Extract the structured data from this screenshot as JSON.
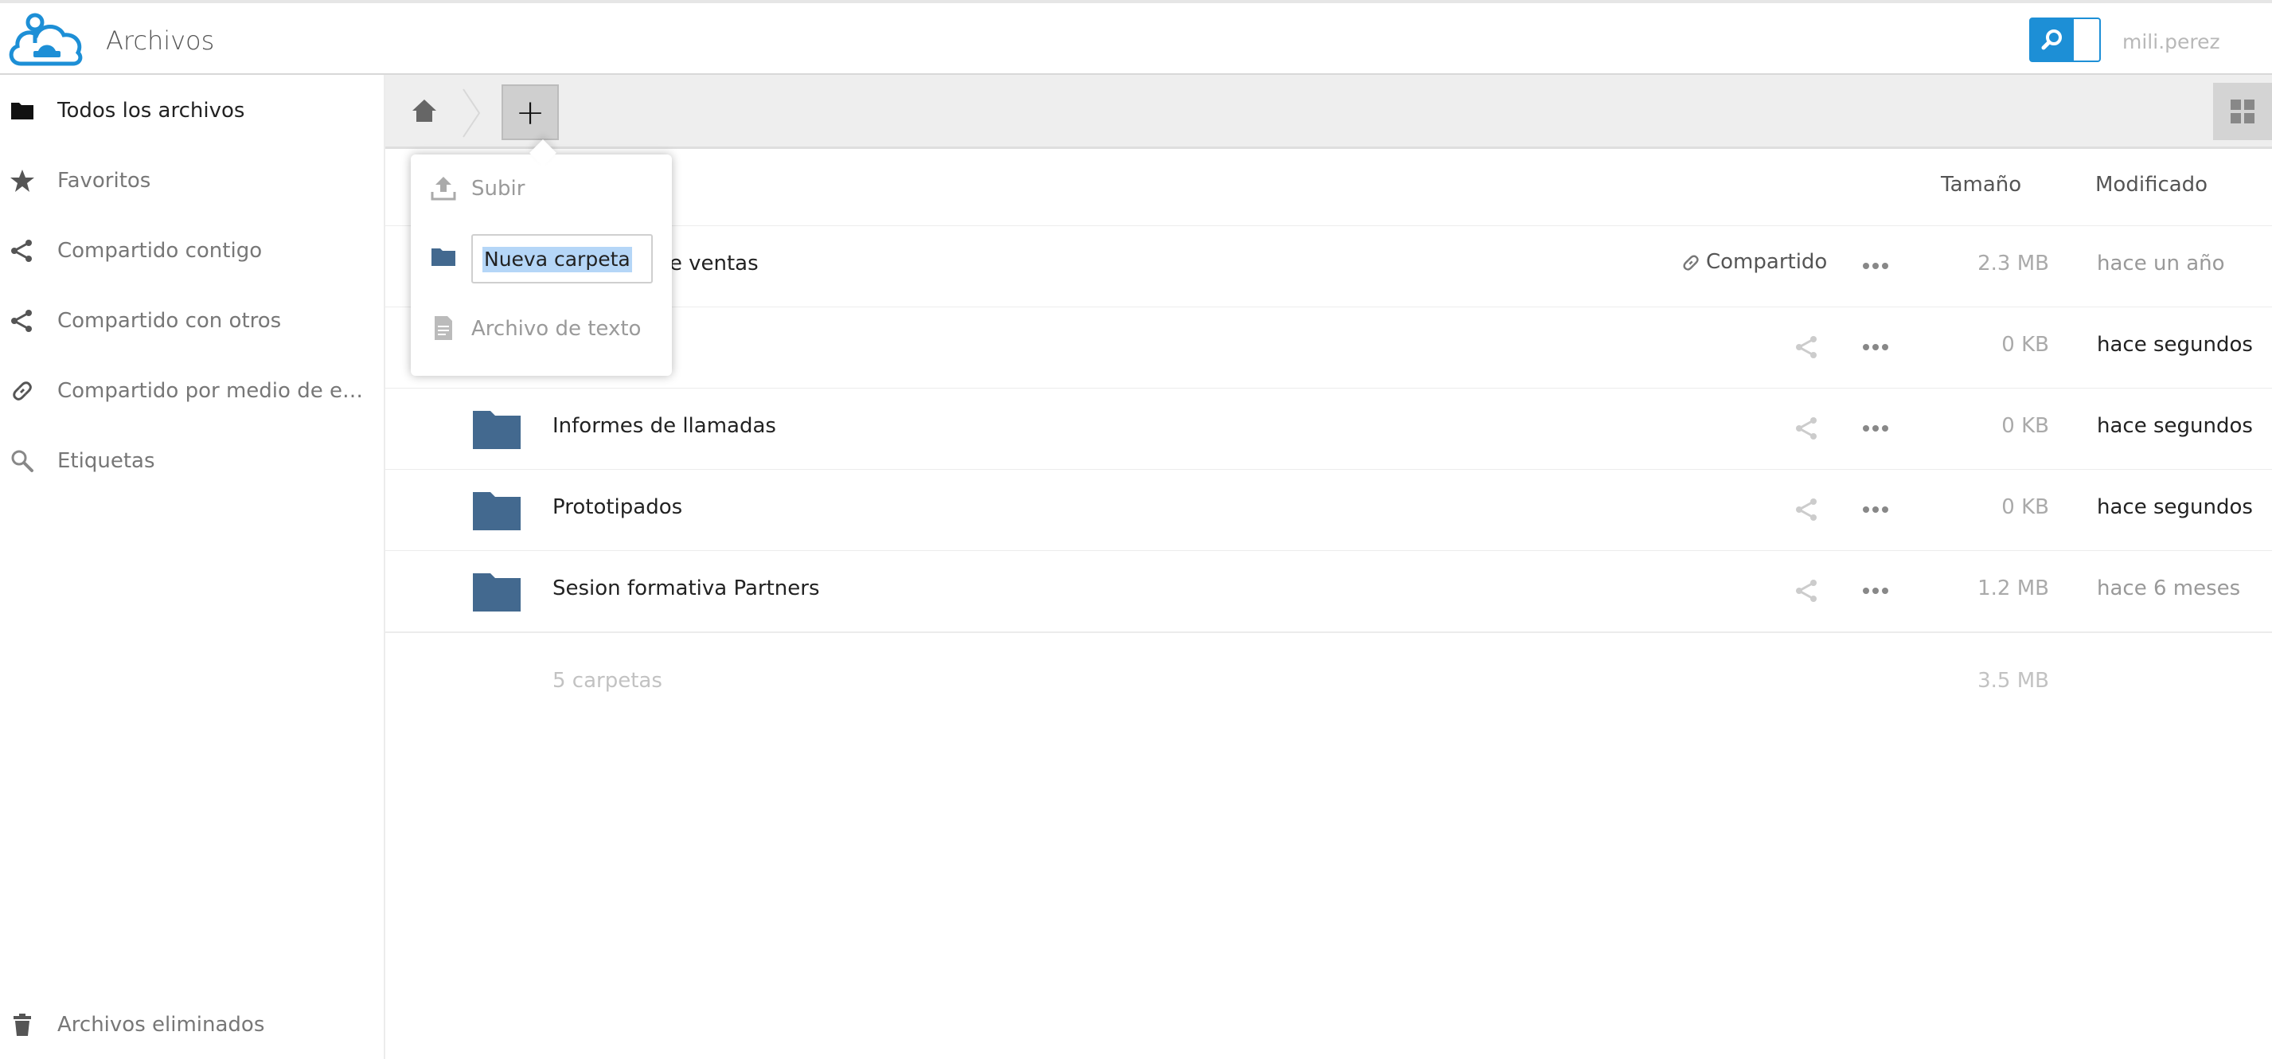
{
  "header": {
    "app_title": "Archivos",
    "username": "mili.perez",
    "accent_color": "#1d8fd6"
  },
  "sidebar": {
    "items": [
      {
        "label": "Todos los archivos",
        "icon": "folder-icon"
      },
      {
        "label": "Favoritos",
        "icon": "star-icon"
      },
      {
        "label": "Compartido contigo",
        "icon": "share-icon"
      },
      {
        "label": "Compartido con otros",
        "icon": "share-icon"
      },
      {
        "label": "Compartido por medio de enlac...",
        "icon": "link-icon"
      },
      {
        "label": "Etiquetas",
        "icon": "tag-search-icon"
      }
    ],
    "trash_label": "Archivos eliminados"
  },
  "controls": {
    "new_button_label": "+"
  },
  "new_menu": {
    "upload_label": "Subir",
    "new_folder_value": "Nueva carpeta",
    "text_file_label": "Archivo de texto"
  },
  "table": {
    "col_size": "Tamaño",
    "col_modified": "Modificado",
    "rows": [
      {
        "name": "to de ventas",
        "shared_label": "Compartido",
        "size": "2.3 MB",
        "modified": "hace un año"
      },
      {
        "name": "",
        "size": "0 KB",
        "modified": "hace segundos"
      },
      {
        "name": "Informes de llamadas",
        "size": "0 KB",
        "modified": "hace segundos"
      },
      {
        "name": "Prototipados",
        "size": "0 KB",
        "modified": "hace segundos"
      },
      {
        "name": "Sesion formativa Partners",
        "size": "1.2 MB",
        "modified": "hace 6 meses"
      }
    ],
    "summary": {
      "count": "5 carpetas",
      "total_size": "3.5 MB"
    }
  },
  "colors": {
    "folder": "#43698f",
    "modified_recent": "#222222",
    "modified_old": "#999999"
  }
}
